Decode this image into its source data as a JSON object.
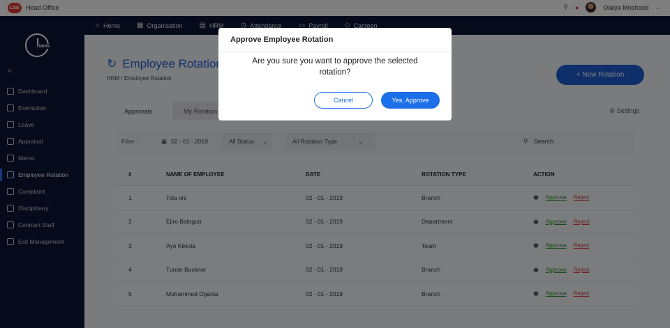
{
  "topbar": {
    "brand_logo_text": "LSE",
    "org_name": "Head Office",
    "user_name": "Olaiya Moshood"
  },
  "sidebar": {
    "logo_text": "tams",
    "collapse_symbol": "«",
    "items": [
      {
        "label": "Dashboard",
        "icon": "dashboard-icon"
      },
      {
        "label": "Exemption",
        "icon": "exemption-icon"
      },
      {
        "label": "Leave",
        "icon": "leave-icon"
      },
      {
        "label": "Appraisal",
        "icon": "appraisal-icon"
      },
      {
        "label": "Memo",
        "icon": "memo-icon"
      },
      {
        "label": "Employee Rotation",
        "icon": "rotation-icon",
        "active": true
      },
      {
        "label": "Complaint",
        "icon": "complaint-icon"
      },
      {
        "label": "Disciplinary",
        "icon": "warning-icon"
      },
      {
        "label": "Contract Staff",
        "icon": "user-icon"
      },
      {
        "label": "Exit Management",
        "icon": "exit-icon"
      }
    ]
  },
  "nav": {
    "items": [
      {
        "label": "Home",
        "icon": "home-icon"
      },
      {
        "label": "Organisation",
        "icon": "building-icon"
      },
      {
        "label": "HRM",
        "icon": "hrm-icon"
      },
      {
        "label": "Attendance",
        "icon": "clock-icon"
      },
      {
        "label": "Payroll",
        "icon": "payroll-icon"
      },
      {
        "label": "Canteen",
        "icon": "canteen-icon"
      }
    ]
  },
  "main": {
    "title": "Employee Rotation",
    "breadcrumb": "HRM / Employee Rotation",
    "new_button": "+ New Rotation",
    "tabs": [
      "Approvals",
      "My Rotation"
    ],
    "settings_label": "Settings",
    "filter": {
      "label": "Filter :",
      "date": "02 - 01 - 2019",
      "status": "All Status",
      "rotation_type": "All Rotation Type",
      "search_placeholder": "Search"
    },
    "table": {
      "headers": [
        "#",
        "NAME OF EMPLOYEE",
        "DATE",
        "ROTATION TYPE",
        "ACTION"
      ],
      "rows": [
        {
          "num": "1",
          "name": "Tola oni",
          "date": "02 - 01 - 2019",
          "type": "Branch"
        },
        {
          "num": "2",
          "name": "Ejiro Balogun",
          "date": "02 - 01 - 2019",
          "type": "Department"
        },
        {
          "num": "3",
          "name": "Ayo Kikiola",
          "date": "02 - 01 - 2019",
          "type": "Team"
        },
        {
          "num": "4",
          "name": "Tunde Bucknor",
          "date": "02 - 01 - 2019",
          "type": "Branch"
        },
        {
          "num": "5",
          "name": "Mohammed Oganla",
          "date": "02 - 01 - 2019",
          "type": "Branch"
        }
      ],
      "approve_label": "Approve",
      "reject_label": "Reject"
    }
  },
  "modal": {
    "title": "Approve Employee Rotation",
    "message": "Are you sure you want to approve the selected rotation?",
    "cancel_label": "Cancel",
    "confirm_label": "Yes, Approve"
  },
  "colors": {
    "sidebar_bg": "#0b1737",
    "accent": "#1f62d8",
    "approve": "#2a8a2a",
    "reject": "#d33333"
  }
}
